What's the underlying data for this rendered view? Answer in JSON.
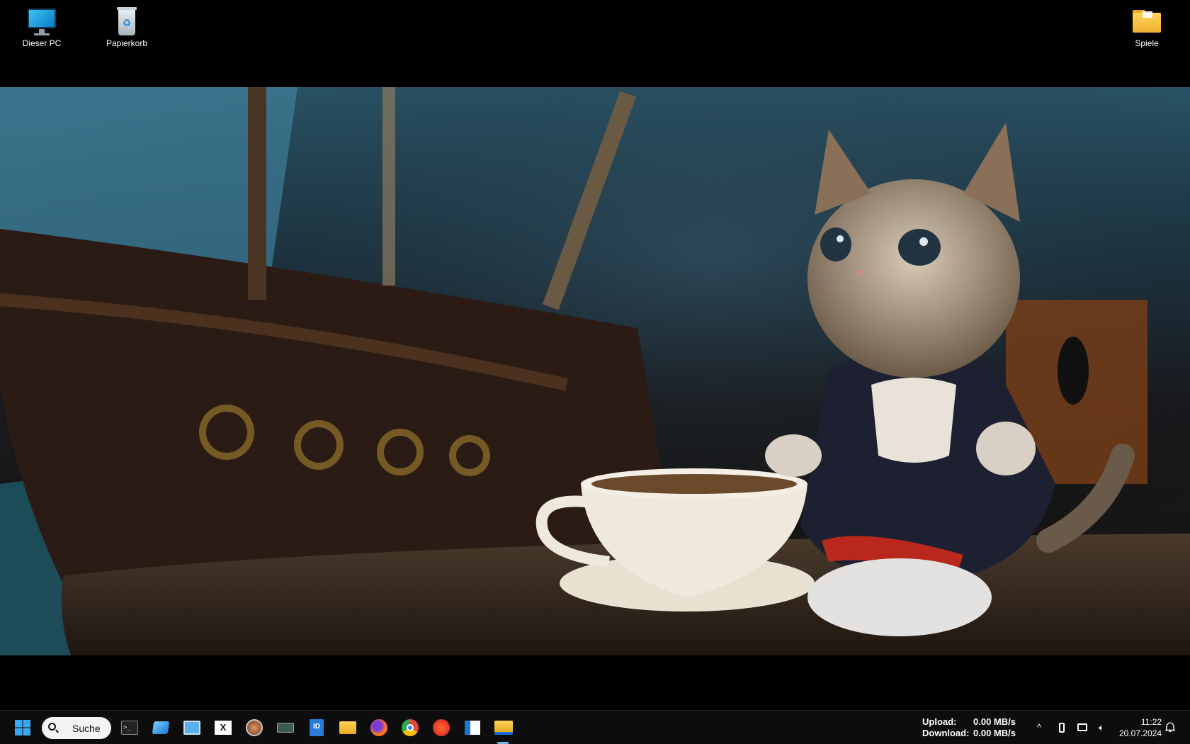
{
  "desktop": {
    "icons": [
      {
        "label": "Dieser PC",
        "icon": "monitor-icon"
      },
      {
        "label": "Papierkorb",
        "icon": "recycle-bin-icon"
      },
      {
        "label": "Spiele",
        "icon": "folder-icon"
      }
    ]
  },
  "taskbar": {
    "start_icon": "windows-start-icon",
    "search_label": "Suche",
    "apps": [
      {
        "icon": "terminal-icon"
      },
      {
        "icon": "window-app-icon"
      },
      {
        "icon": "remote-desktop-icon"
      },
      {
        "icon": "excel-like-icon"
      },
      {
        "icon": "profile-app-icon"
      },
      {
        "icon": "keyboard-app-icon"
      },
      {
        "icon": "id-app-icon"
      },
      {
        "icon": "file-explorer-icon"
      },
      {
        "icon": "firefox-icon"
      },
      {
        "icon": "chrome-icon"
      },
      {
        "icon": "media-player-icon"
      },
      {
        "icon": "app-window-icon"
      },
      {
        "icon": "folder-pinned-icon"
      }
    ],
    "netstats": {
      "upload_label": "Upload:",
      "upload_value": "0.00 MB/s",
      "download_label": "Download:",
      "download_value": "0.00 MB/s"
    },
    "tray": {
      "chevron": "^"
    },
    "clock": {
      "time": "11:22",
      "date": "20.07.2024"
    }
  }
}
